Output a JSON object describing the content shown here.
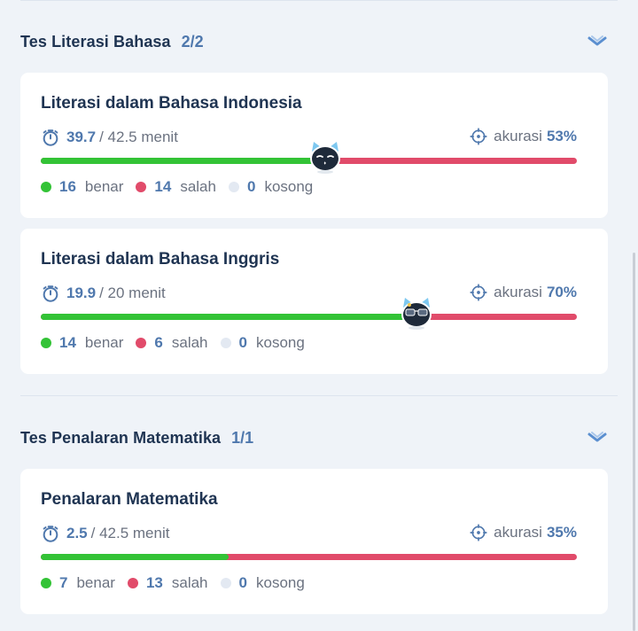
{
  "sections": [
    {
      "title": "Tes Literasi Bahasa",
      "count": "2/2",
      "cards": [
        {
          "title": "Literasi dalam Bahasa Indonesia",
          "time_used": "39.7",
          "time_total": "/ 42.5 menit",
          "accuracy_label": "akurasi",
          "accuracy": "53%",
          "progress_fraction": 0.53,
          "mascot": "sleepy-cat-icon",
          "benar": "16",
          "benar_label": "benar",
          "salah": "14",
          "salah_label": "salah",
          "kosong": "0",
          "kosong_label": "kosong"
        },
        {
          "title": "Literasi dalam Bahasa Inggris",
          "time_used": "19.9",
          "time_total": "/ 20 menit",
          "accuracy_label": "akurasi",
          "accuracy": "70%",
          "progress_fraction": 0.7,
          "mascot": "sunglasses-cat-icon",
          "benar": "14",
          "benar_label": "benar",
          "salah": "6",
          "salah_label": "salah",
          "kosong": "0",
          "kosong_label": "kosong"
        }
      ]
    },
    {
      "title": "Tes Penalaran Matematika",
      "count": "1/1",
      "cards": [
        {
          "title": "Penalaran Matematika",
          "time_used": "2.5",
          "time_total": "/ 42.5 menit",
          "accuracy_label": "akurasi",
          "accuracy": "35%",
          "progress_fraction": 0.35,
          "benar": "7",
          "benar_label": "benar",
          "salah": "13",
          "salah_label": "salah",
          "kosong": "0",
          "kosong_label": "kosong"
        }
      ]
    }
  ],
  "colors": {
    "correct": "#33c336",
    "wrong": "#e14b6a",
    "empty": "#e3e9f2",
    "accent": "#4f78ad",
    "heading": "#1f3452"
  }
}
